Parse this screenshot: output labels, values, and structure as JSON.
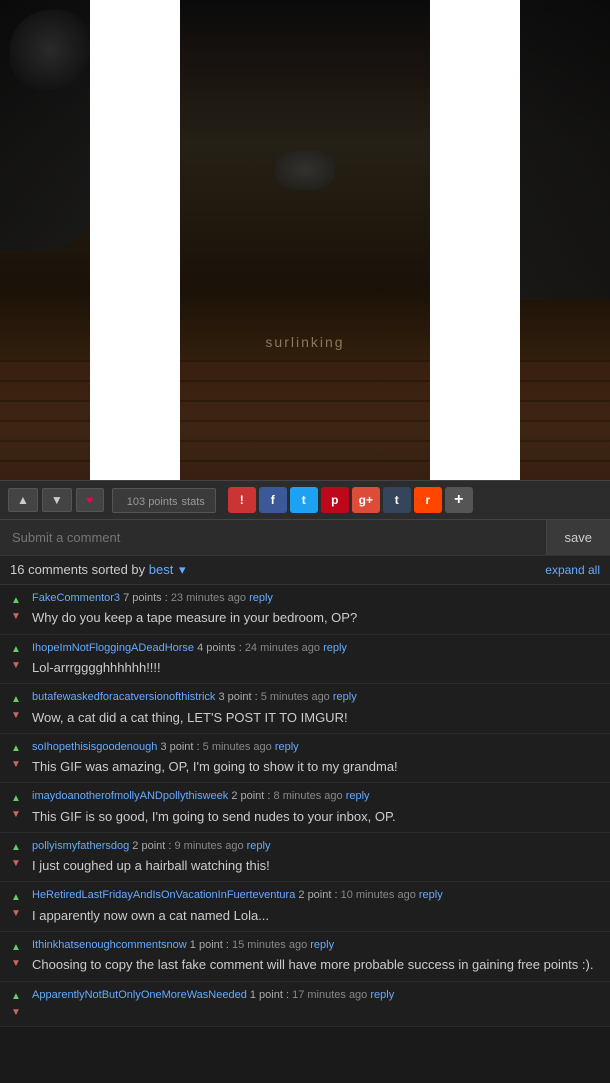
{
  "image": {
    "alt": "Cat GIF image"
  },
  "toolbar": {
    "upvote_label": "▲",
    "downvote_label": "▼",
    "heart_label": "♥",
    "points": "103 points",
    "stats_label": "stats",
    "exclaim_label": "!",
    "fb_label": "f",
    "tw_label": "t",
    "pi_label": "p",
    "gp_label": "g+",
    "tu_label": "t",
    "rd_label": "r",
    "plus_label": "+"
  },
  "submit": {
    "placeholder": "Submit a comment",
    "save_label": "save"
  },
  "comments_header": {
    "count": "16",
    "sorted_by": "comments sorted by",
    "sort": "best",
    "expand_label": "expand all"
  },
  "comments": [
    {
      "author": "FakeCommentor3",
      "points": "7 points",
      "time": "23 minutes ago",
      "reply": "reply",
      "text": "Why do you keep a tape measure in your bedroom, OP?"
    },
    {
      "author": "IhopeImNotFloggingADeadHorse",
      "points": "4 points",
      "time": "24 minutes ago",
      "reply": "reply",
      "text": "Lol-arrrgggghhhhhh!!!!"
    },
    {
      "author": "butafewaskedforacatversionofthistrick",
      "points": "3 point",
      "time": "5 minutes ago",
      "reply": "reply",
      "text": "Wow, a cat did a cat thing, LET'S POST IT TO IMGUR!"
    },
    {
      "author": "soIhopethisisgoodenough",
      "points": "3 point",
      "time": "5 minutes ago",
      "reply": "reply",
      "text": "This GIF was amazing, OP, I'm going to show it to my grandma!"
    },
    {
      "author": "imaydoanotherofmollyANDpollythisweek",
      "points": "2 point",
      "time": "8 minutes ago",
      "reply": "reply",
      "text": "This GIF is so good, I'm going to send nudes to your inbox, OP."
    },
    {
      "author": "pollyismyfathersdog",
      "points": "2 point",
      "time": "9 minutes ago",
      "reply": "reply",
      "text": "I just coughed up a hairball watching this!"
    },
    {
      "author": "HeRetiredLastFridayAndIsOnVacationInFuerteventura",
      "points": "2 point",
      "time": "10 minutes ago",
      "reply": "reply",
      "text": "I apparently now own a cat named Lola..."
    },
    {
      "author": "Ithinkhatsenoughcommentsnow",
      "points": "1 point",
      "time": "15 minutes ago",
      "reply": "reply",
      "text": "Choosing to copy the last fake comment will have more probable success in gaining free points :)."
    },
    {
      "author": "ApparentlyNotButOnlyOneMoreWasNeeded",
      "points": "1 point",
      "time": "17 minutes ago",
      "reply": "reply",
      "text": ""
    }
  ]
}
